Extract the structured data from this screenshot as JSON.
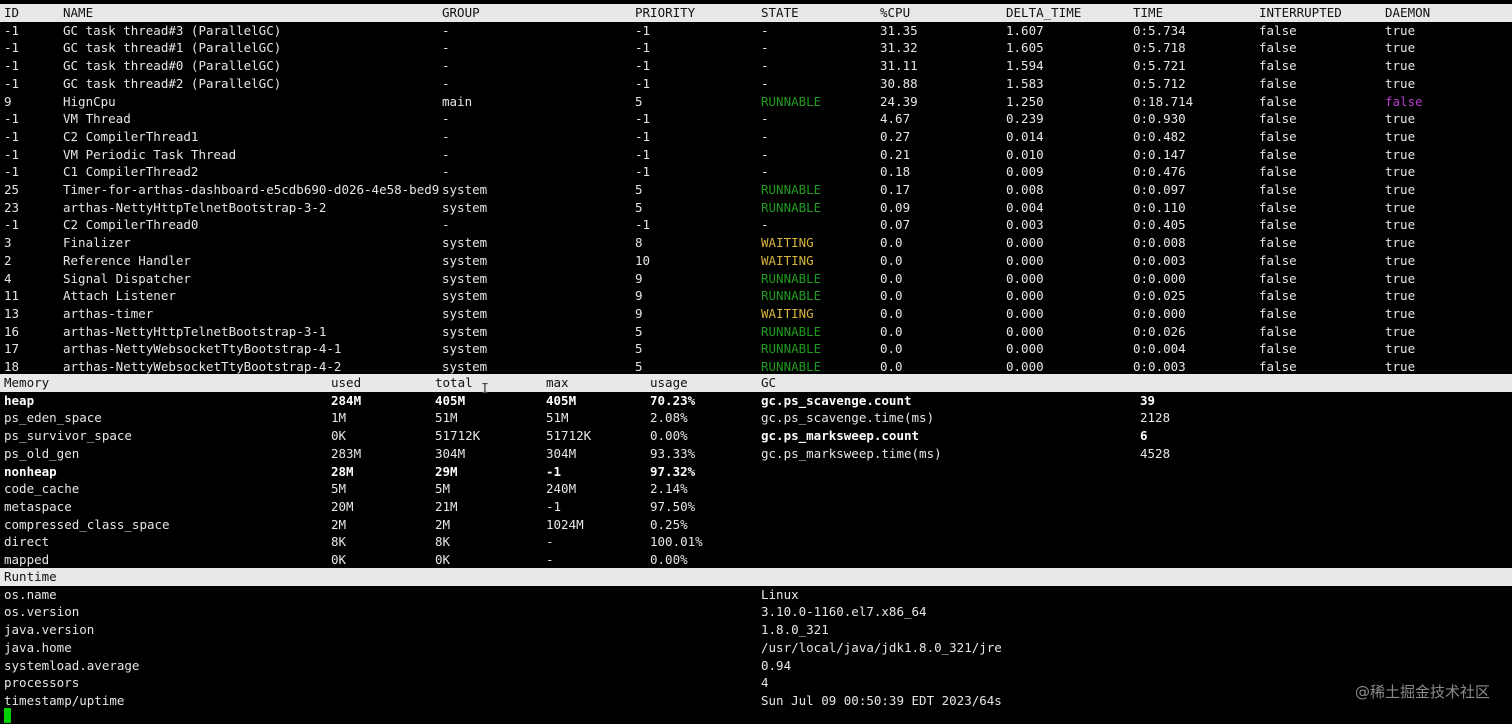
{
  "thread_table": {
    "headers": [
      "ID",
      "NAME",
      "GROUP",
      "PRIORITY",
      "STATE",
      "%CPU",
      "DELTA_TIME",
      "TIME",
      "INTERRUPTED",
      "DAEMON"
    ],
    "rows": [
      [
        "-1",
        "GC task thread#3 (ParallelGC)",
        "-",
        "-1",
        "-",
        "31.35",
        "1.607",
        "0:5.734",
        "false",
        "true"
      ],
      [
        "-1",
        "GC task thread#1 (ParallelGC)",
        "-",
        "-1",
        "-",
        "31.32",
        "1.605",
        "0:5.718",
        "false",
        "true"
      ],
      [
        "-1",
        "GC task thread#0 (ParallelGC)",
        "-",
        "-1",
        "-",
        "31.11",
        "1.594",
        "0:5.721",
        "false",
        "true"
      ],
      [
        "-1",
        "GC task thread#2 (ParallelGC)",
        "-",
        "-1",
        "-",
        "30.88",
        "1.583",
        "0:5.712",
        "false",
        "true"
      ],
      [
        "9",
        "HignCpu",
        "main",
        "5",
        "RUNNABLE",
        "24.39",
        "1.250",
        "0:18.714",
        "false",
        "false"
      ],
      [
        "-1",
        "VM Thread",
        "-",
        "-1",
        "-",
        "4.67",
        "0.239",
        "0:0.930",
        "false",
        "true"
      ],
      [
        "-1",
        "C2 CompilerThread1",
        "-",
        "-1",
        "-",
        "0.27",
        "0.014",
        "0:0.482",
        "false",
        "true"
      ],
      [
        "-1",
        "VM Periodic Task Thread",
        "-",
        "-1",
        "-",
        "0.21",
        "0.010",
        "0:0.147",
        "false",
        "true"
      ],
      [
        "-1",
        "C1 CompilerThread2",
        "-",
        "-1",
        "-",
        "0.18",
        "0.009",
        "0:0.476",
        "false",
        "true"
      ],
      [
        "25",
        "Timer-for-arthas-dashboard-e5cdb690-d026-4e58-bed9",
        "system",
        "5",
        "RUNNABLE",
        "0.17",
        "0.008",
        "0:0.097",
        "false",
        "true"
      ],
      [
        "23",
        "arthas-NettyHttpTelnetBootstrap-3-2",
        "system",
        "5",
        "RUNNABLE",
        "0.09",
        "0.004",
        "0:0.110",
        "false",
        "true"
      ],
      [
        "-1",
        "C2 CompilerThread0",
        "-",
        "-1",
        "-",
        "0.07",
        "0.003",
        "0:0.405",
        "false",
        "true"
      ],
      [
        "3",
        "Finalizer",
        "system",
        "8",
        "WAITING",
        "0.0",
        "0.000",
        "0:0.008",
        "false",
        "true"
      ],
      [
        "2",
        "Reference Handler",
        "system",
        "10",
        "WAITING",
        "0.0",
        "0.000",
        "0:0.003",
        "false",
        "true"
      ],
      [
        "4",
        "Signal Dispatcher",
        "system",
        "9",
        "RUNNABLE",
        "0.0",
        "0.000",
        "0:0.000",
        "false",
        "true"
      ],
      [
        "11",
        "Attach Listener",
        "system",
        "9",
        "RUNNABLE",
        "0.0",
        "0.000",
        "0:0.025",
        "false",
        "true"
      ],
      [
        "13",
        "arthas-timer",
        "system",
        "9",
        "WAITING",
        "0.0",
        "0.000",
        "0:0.000",
        "false",
        "true"
      ],
      [
        "16",
        "arthas-NettyHttpTelnetBootstrap-3-1",
        "system",
        "5",
        "RUNNABLE",
        "0.0",
        "0.000",
        "0:0.026",
        "false",
        "true"
      ],
      [
        "17",
        "arthas-NettyWebsocketTtyBootstrap-4-1",
        "system",
        "5",
        "RUNNABLE",
        "0.0",
        "0.000",
        "0:0.004",
        "false",
        "true"
      ],
      [
        "18",
        "arthas-NettyWebsocketTtyBootstrap-4-2",
        "system",
        "5",
        "RUNNABLE",
        "0.0",
        "0.000",
        "0:0.003",
        "false",
        "true"
      ]
    ]
  },
  "memory_table": {
    "headers": [
      "Memory",
      "used",
      "total",
      "max",
      "usage"
    ],
    "rows": [
      [
        "heap",
        "284M",
        "405M",
        "405M",
        "70.23%"
      ],
      [
        "ps_eden_space",
        "1M",
        "51M",
        "51M",
        "2.08%"
      ],
      [
        "ps_survivor_space",
        "0K",
        "51712K",
        "51712K",
        "0.00%"
      ],
      [
        "ps_old_gen",
        "283M",
        "304M",
        "304M",
        "93.33%"
      ],
      [
        "nonheap",
        "28M",
        "29M",
        "-1",
        "97.32%"
      ],
      [
        "code_cache",
        "5M",
        "5M",
        "240M",
        "2.14%"
      ],
      [
        "metaspace",
        "20M",
        "21M",
        "-1",
        "97.50%"
      ],
      [
        "compressed_class_space",
        "2M",
        "2M",
        "1024M",
        "0.25%"
      ],
      [
        "direct",
        "8K",
        "8K",
        "-",
        "100.01%"
      ],
      [
        "mapped",
        "0K",
        "0K",
        "-",
        "0.00%"
      ]
    ]
  },
  "gc_table": {
    "header": "GC",
    "rows": [
      [
        "gc.ps_scavenge.count",
        "39"
      ],
      [
        "gc.ps_scavenge.time(ms)",
        "2128"
      ],
      [
        "gc.ps_marksweep.count",
        "6"
      ],
      [
        "gc.ps_marksweep.time(ms)",
        "4528"
      ]
    ]
  },
  "runtime_table": {
    "header": "Runtime",
    "rows": [
      [
        "os.name",
        "Linux"
      ],
      [
        "os.version",
        "3.10.0-1160.el7.x86_64"
      ],
      [
        "java.version",
        "1.8.0_321"
      ],
      [
        "java.home",
        "/usr/local/java/jdk1.8.0_321/jre"
      ],
      [
        "systemload.average",
        "0.94"
      ],
      [
        "processors",
        "4"
      ],
      [
        "timestamp/uptime",
        "Sun Jul 09 00:50:39 EDT 2023/64s"
      ]
    ]
  },
  "watermark": "@稀土掘金技术社区",
  "colors": {
    "runnable": "#1f9a1f",
    "waiting": "#d6b43a",
    "daemon_false": "#b53cc9",
    "header_bg": "#e8e8e8"
  }
}
